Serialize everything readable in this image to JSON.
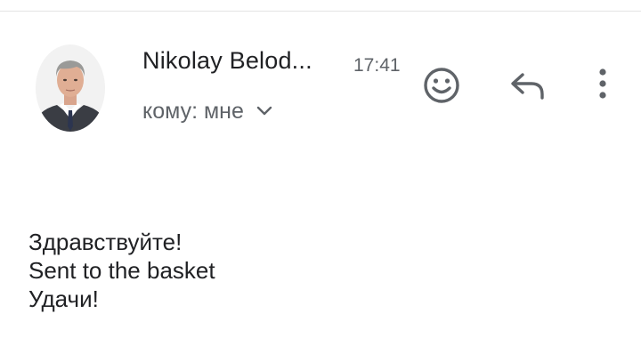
{
  "message": {
    "sender_name": "Nikolay Belod...",
    "time": "17:41",
    "recipient": "кому: мне",
    "body_lines": [
      "Здравствуйте!",
      "Sent to the basket",
      "Удачи!"
    ]
  },
  "icons": {
    "avatar": "sender-avatar-photo",
    "emoji": "add-reaction-icon",
    "reply": "reply-icon",
    "more": "more-vert-icon",
    "expand": "chevron-down-icon"
  },
  "colors": {
    "text_primary": "#202124",
    "text_secondary": "#5f6368",
    "icon": "#5f6368"
  }
}
